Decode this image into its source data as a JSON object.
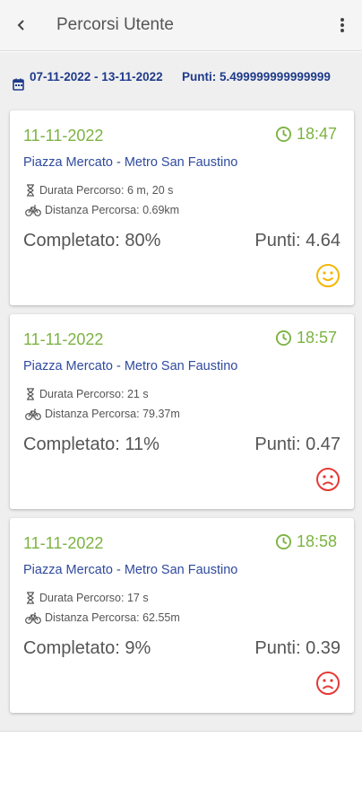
{
  "header": {
    "title": "Percorsi Utente",
    "back_icon": "arrow-back-icon",
    "menu_icon": "more-vert-icon"
  },
  "summary": {
    "period": "07-11-2022 - 13-11-2022",
    "points": "Punti: 5.499999999999999",
    "accent_color": "#1e3a8a"
  },
  "colors": {
    "date_green": "#7cb342",
    "route_blue": "#2f4a9e",
    "happy_yellow": "#f2b705",
    "sad_red": "#e53935"
  },
  "routes": [
    {
      "date": "11-11-2022",
      "time": "18:47",
      "route": "Piazza Mercato - Metro San Faustino",
      "duration": "Durata Percorso: 6 m, 20 s",
      "distance": "Distanza Percorsa: 0.69km",
      "completed": "Completato: 80%",
      "points": "Punti: 4.64",
      "mood": "happy"
    },
    {
      "date": "11-11-2022",
      "time": "18:57",
      "route": "Piazza Mercato - Metro San Faustino",
      "duration": "Durata Percorso: 21 s",
      "distance": "Distanza Percorsa: 79.37m",
      "completed": "Completato: 11%",
      "points": "Punti: 0.47",
      "mood": "sad"
    },
    {
      "date": "11-11-2022",
      "time": "18:58",
      "route": "Piazza Mercato - Metro San Faustino",
      "duration": "Durata Percorso: 17 s",
      "distance": "Distanza Percorsa: 62.55m",
      "completed": "Completato: 9%",
      "points": "Punti: 0.39",
      "mood": "sad"
    }
  ]
}
